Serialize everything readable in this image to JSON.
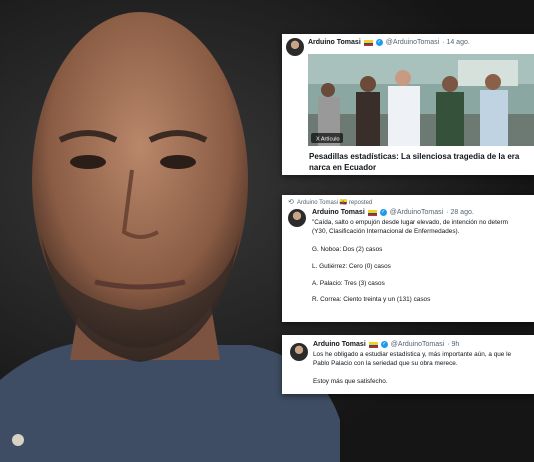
{
  "tweet1": {
    "name": "Arduino Tomasi",
    "handle": "@ArduinoTomasi",
    "date": "· 14 ago.",
    "badge": "X Artículo",
    "headline_line1": "Pesadillas estadísticas: La silenciosa tragedia de la era",
    "headline_line2": "narca en Ecuador"
  },
  "tweet2": {
    "repost_label": "Arduino Tomasi 🇪🇨 reposted",
    "name": "Arduino Tomasi",
    "handle": "@ArduinoTomasi",
    "date": "· 28 ago.",
    "line1": "\"Caída, salto o empujón desde lugar elevado, de intención no determ",
    "line2": "(Y30, Clasificación Internacional de Enfermedades).",
    "stat1": "G. Noboa: Dos (2) casos",
    "stat2": "L. Gutiérrez: Cero (0) casos",
    "stat3": "A. Palacio: Tres (3) casos",
    "stat4": "R. Correa: Ciento treinta y un (131) casos"
  },
  "tweet3": {
    "name": "Arduino Tomasi",
    "handle": "@ArduinoTomasi",
    "date": "· 9h",
    "line1": "Los he obligado a estudiar estadística y, más importante aún, a que le",
    "line2": "Pablo Palacio con la seriedad que su obra merece.",
    "line3": "Estoy más que satisfecho."
  },
  "icons": {
    "verified": "verified-badge-icon",
    "repost": "repost-icon",
    "flag": "ecuador-flag-icon"
  }
}
